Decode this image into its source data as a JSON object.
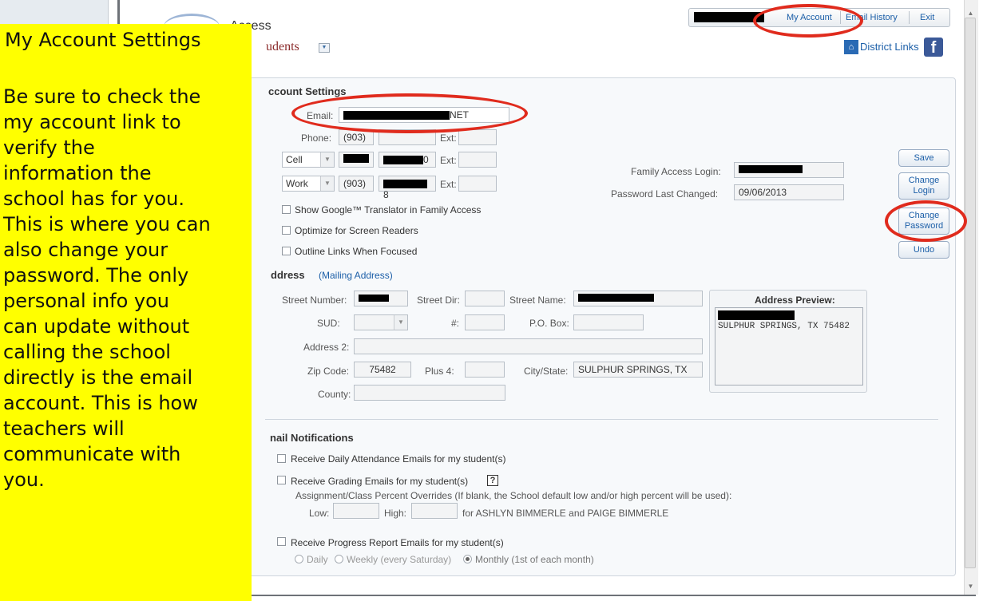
{
  "app": {
    "title": "Access",
    "students_label": "udents",
    "district_links": "District Links"
  },
  "topnav": {
    "my_account": "My Account",
    "email_history": "Email History",
    "exit": "Exit"
  },
  "account": {
    "heading": "ccount Settings",
    "email_label": "Email:",
    "email_value": "NET",
    "phone_label": "Phone:",
    "phone_area": "(903)",
    "ext_label": "Ext:",
    "cell_type": "Cell",
    "cell_tail": "0",
    "work_type": "Work",
    "work_area": "(903)",
    "work_tail": "8",
    "login_label": "Family Access Login:",
    "pwd_changed_label": "Password Last Changed:",
    "pwd_changed_value": "09/06/2013",
    "options": [
      "Show Google™ Translator in Family Access",
      "Optimize for Screen Readers",
      "Outline Links When Focused"
    ]
  },
  "buttons": {
    "save": "Save",
    "change_login": "Change Login",
    "change_password": "Change Password",
    "undo": "Undo"
  },
  "address": {
    "heading": "ddress",
    "mailing": "(Mailing Address)",
    "street_number_label": "Street Number:",
    "street_dir_label": "Street Dir:",
    "street_name_label": "Street Name:",
    "sud_label": "SUD:",
    "hash_label": "#:",
    "po_box_label": "P.O. Box:",
    "address2_label": "Address 2:",
    "zip_label": "Zip Code:",
    "zip_value": "75482",
    "plus4_label": "Plus 4:",
    "city_label": "City/State:",
    "city_value": "SULPHUR SPRINGS, TX",
    "county_label": "County:",
    "preview_label": "Address Preview:",
    "preview_line": "SULPHUR SPRINGS, TX 75482"
  },
  "notifications": {
    "heading": "nail Notifications",
    "attendance": "Receive Daily Attendance Emails for my student(s)",
    "grading": "Receive Grading Emails for my student(s)",
    "help": "?",
    "overrides": "Assignment/Class Percent Overrides (If blank, the School default low and/or high percent will be used):",
    "low_label": "Low:",
    "high_label": "High:",
    "for_students": "for ASHLYN BIMMERLE and PAIGE BIMMERLE",
    "progress": "Receive Progress Report Emails for my student(s)",
    "freq_daily": "Daily",
    "freq_weekly": "Weekly (every Saturday)",
    "freq_monthly": "Monthly (1st of each month)"
  },
  "callout": {
    "title": "My Account Settings",
    "body": "Be sure to check the\nmy account link to\nverify the\ninformation the\nschool has for you.\nThis is where you can\nalso change your\npassword.  The only\npersonal info you\ncan update without\ncalling the school\ndirectly is the email\naccount.  This is how\nteachers will\ncommunicate with\nyou."
  },
  "colors": {
    "highlight": "#ffff00",
    "annotation_ring": "#e02b1d",
    "link": "#1c5fa8"
  }
}
